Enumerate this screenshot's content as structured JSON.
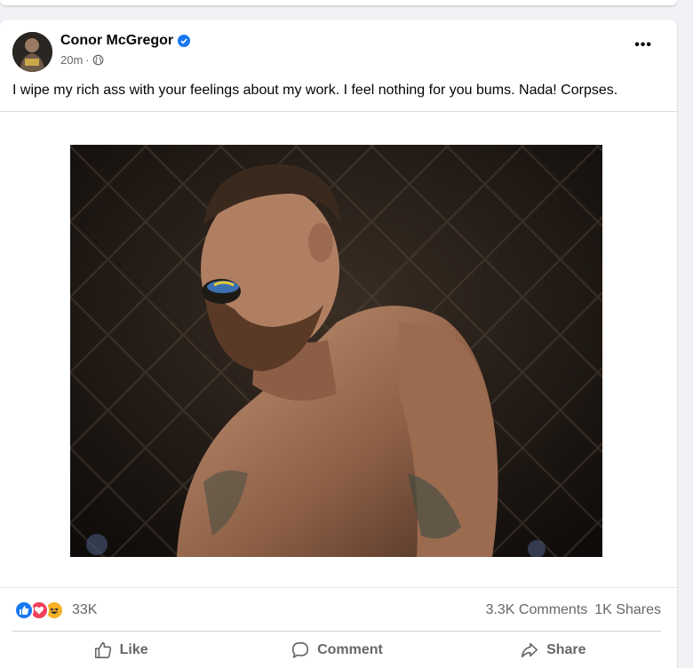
{
  "post": {
    "author": "Conor McGregor",
    "time": "20m",
    "separator": "·",
    "text": "I wipe my rich ass with your feelings about my work. I feel nothing for you bums. Nada! Corpses.",
    "more_label": "•••"
  },
  "stats": {
    "reactions_count": "33K",
    "comments": "3.3K Comments",
    "shares": "1K Shares"
  },
  "actions": {
    "like": "Like",
    "comment": "Comment",
    "share": "Share"
  },
  "colors": {
    "brand": "#1877f2",
    "love": "#f33e58",
    "haha": "#f7b125",
    "secondary_text": "#65676b"
  },
  "icons": [
    "verified-badge-icon",
    "globe-icon",
    "more-options-icon",
    "like-reaction-icon",
    "love-reaction-icon",
    "haha-reaction-icon",
    "thumbs-up-icon",
    "comment-icon",
    "share-icon"
  ]
}
